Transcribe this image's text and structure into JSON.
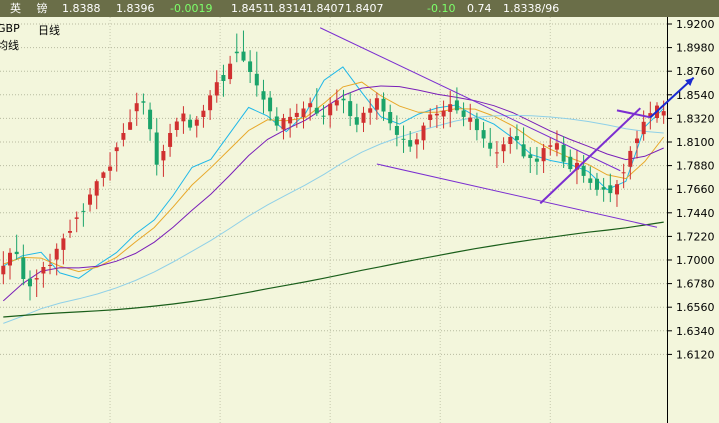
{
  "header": {
    "name": "英 镑",
    "fields": [
      {
        "text": "1.8388",
        "color": "pos"
      },
      {
        "text": "1.8396",
        "color": "pos"
      },
      {
        "text": "-0.0019",
        "color": "neg"
      },
      {
        "text": "1.8451",
        "color": "pos"
      },
      {
        "text": "1.8314",
        "color": "pos"
      },
      {
        "text": "1.8407",
        "color": "pos"
      },
      {
        "text": "1.8407",
        "color": "pos"
      },
      {
        "text": "-0.10",
        "color": "neg"
      },
      {
        "text": "0.74",
        "color": "pos"
      },
      {
        "text": "1.8338/96",
        "color": "pos"
      }
    ]
  },
  "legend": {
    "symbol": "GBP",
    "period": "日线",
    "indicator": "均线"
  },
  "colors": {
    "background": "#f3f6dc",
    "header_bg": "#6a6e48",
    "up_candle": "#d03030",
    "down_candle": "#1aa36a",
    "ma_short": "#1fb8e8",
    "ma_mid": "#e8a82a",
    "ma_long1": "#7a1fb8",
    "ma_long2": "#8fd0e8",
    "ma_long3": "#1a5e1a",
    "trendline": "#7b2ed0",
    "arrow": "#1a2ad0"
  },
  "chart_data": {
    "type": "candlestick",
    "title": "",
    "xlabel": "",
    "ylabel": "",
    "ylim": [
      1.5982,
      1.9265
    ],
    "y_ticks": [
      "1.9200",
      "1.8980",
      "1.8760",
      "1.8540",
      "1.8320",
      "1.8100",
      "1.7880",
      "1.7660",
      "1.7440",
      "1.7220",
      "1.7000",
      "1.6780",
      "1.6560",
      "1.6340",
      "1.6120"
    ],
    "grid": true,
    "series": [
      {
        "name": "MA short",
        "values": [
          1.6943,
          1.7039,
          1.7072,
          1.688,
          1.6829,
          1.6954,
          1.7069,
          1.7242,
          1.7374,
          1.7601,
          1.7863,
          1.7939,
          1.818,
          1.8423,
          1.8341,
          1.8197,
          1.8363,
          1.8676,
          1.8799,
          1.8562,
          1.8336,
          1.8267,
          1.836,
          1.8418,
          1.8445,
          1.8342,
          1.8267,
          1.8139,
          1.7982,
          1.7928,
          1.7894,
          1.7826,
          1.7656,
          1.7734,
          1.8241,
          1.8414
        ]
      },
      {
        "name": "MA mid",
        "values": [
          1.6962,
          1.7024,
          1.7018,
          1.6943,
          1.6892,
          1.6935,
          1.7025,
          1.7168,
          1.7303,
          1.7495,
          1.7699,
          1.786,
          1.8034,
          1.8207,
          1.8307,
          1.8298,
          1.8326,
          1.8462,
          1.8614,
          1.8658,
          1.8533,
          1.8435,
          1.8377,
          1.8378,
          1.8411,
          1.8407,
          1.8341,
          1.8251,
          1.8129,
          1.8032,
          1.7955,
          1.7891,
          1.7794,
          1.7759,
          1.7918,
          1.8147
        ]
      },
      {
        "name": "MA long 1",
        "values": [
          1.6619,
          1.6777,
          1.6896,
          1.6928,
          1.6926,
          1.6942,
          1.6989,
          1.7061,
          1.7166,
          1.7305,
          1.7464,
          1.7614,
          1.7789,
          1.7973,
          1.8124,
          1.8219,
          1.8302,
          1.8416,
          1.8533,
          1.8602,
          1.8622,
          1.8616,
          1.8584,
          1.8545,
          1.8517,
          1.8485,
          1.8438,
          1.8374,
          1.8288,
          1.8202,
          1.8127,
          1.806,
          1.7988,
          1.7936,
          1.7967,
          1.8044
        ]
      },
      {
        "name": "MA long 2",
        "values": [
          1.6409,
          1.6475,
          1.6546,
          1.6598,
          1.6638,
          1.6684,
          1.6741,
          1.6809,
          1.6889,
          1.6981,
          1.7081,
          1.7183,
          1.7294,
          1.7409,
          1.7514,
          1.7607,
          1.7698,
          1.7799,
          1.7909,
          1.8005,
          1.8082,
          1.8146,
          1.8201,
          1.825,
          1.8297,
          1.8329,
          1.8343,
          1.8348,
          1.8345,
          1.8333,
          1.8315,
          1.8291,
          1.8259,
          1.8224,
          1.8199,
          1.8184
        ]
      },
      {
        "name": "MA long 3",
        "values": [
          1.6469,
          1.6483,
          1.6497,
          1.6507,
          1.6516,
          1.6526,
          1.6538,
          1.6553,
          1.657,
          1.659,
          1.6613,
          1.6638,
          1.6667,
          1.6699,
          1.6732,
          1.6764,
          1.6796,
          1.683,
          1.6867,
          1.6904,
          1.6938,
          1.6973,
          1.7007,
          1.704,
          1.7074,
          1.7105,
          1.7134,
          1.7162,
          1.7188,
          1.7212,
          1.7236,
          1.7259,
          1.7279,
          1.73,
          1.7326,
          1.7353
        ]
      }
    ],
    "candles": [
      {
        "o": 1.6867,
        "h": 1.7082,
        "l": 1.6774,
        "c": 1.6946
      },
      {
        "o": 1.6949,
        "h": 1.711,
        "l": 1.6818,
        "c": 1.7067
      },
      {
        "o": 1.7076,
        "h": 1.7236,
        "l": 1.7003,
        "c": 1.7055
      },
      {
        "o": 1.7023,
        "h": 1.7144,
        "l": 1.6765,
        "c": 1.6823
      },
      {
        "o": 1.6826,
        "h": 1.6903,
        "l": 1.6623,
        "c": 1.6755
      },
      {
        "o": 1.6818,
        "h": 1.6912,
        "l": 1.6655,
        "c": 1.6831
      },
      {
        "o": 1.6874,
        "h": 1.6983,
        "l": 1.6742,
        "c": 1.6935
      },
      {
        "o": 1.6954,
        "h": 1.7058,
        "l": 1.6867,
        "c": 1.6954
      },
      {
        "o": 1.7004,
        "h": 1.7155,
        "l": 1.6857,
        "c": 1.7104
      },
      {
        "o": 1.7094,
        "h": 1.7246,
        "l": 1.6959,
        "c": 1.7201
      },
      {
        "o": 1.7253,
        "h": 1.7376,
        "l": 1.7206,
        "c": 1.727
      },
      {
        "o": 1.7383,
        "h": 1.7452,
        "l": 1.7259,
        "c": 1.7397
      },
      {
        "o": 1.7458,
        "h": 1.7529,
        "l": 1.731,
        "c": 1.7457
      },
      {
        "o": 1.7516,
        "h": 1.7671,
        "l": 1.7451,
        "c": 1.7611
      },
      {
        "o": 1.7601,
        "h": 1.7751,
        "l": 1.7474,
        "c": 1.7735
      },
      {
        "o": 1.7766,
        "h": 1.7826,
        "l": 1.7685,
        "c": 1.7817
      },
      {
        "o": 1.7832,
        "h": 1.8004,
        "l": 1.774,
        "c": 1.7871
      },
      {
        "o": 1.8016,
        "h": 1.8096,
        "l": 1.7824,
        "c": 1.8051
      },
      {
        "o": 1.8121,
        "h": 1.8275,
        "l": 1.8059,
        "c": 1.8184
      },
      {
        "o": 1.8214,
        "h": 1.8404,
        "l": 1.8213,
        "c": 1.8285
      },
      {
        "o": 1.8387,
        "h": 1.8559,
        "l": 1.825,
        "c": 1.8462
      },
      {
        "o": 1.8479,
        "h": 1.8552,
        "l": 1.8356,
        "c": 1.8466
      },
      {
        "o": 1.8401,
        "h": 1.8468,
        "l": 1.8111,
        "c": 1.8219
      },
      {
        "o": 1.8189,
        "h": 1.8321,
        "l": 1.7788,
        "c": 1.7889
      },
      {
        "o": 1.7928,
        "h": 1.8074,
        "l": 1.7775,
        "c": 1.8016
      },
      {
        "o": 1.8054,
        "h": 1.8269,
        "l": 1.7962,
        "c": 1.8184
      },
      {
        "o": 1.8212,
        "h": 1.8326,
        "l": 1.8149,
        "c": 1.8291
      },
      {
        "o": 1.8293,
        "h": 1.8434,
        "l": 1.8176,
        "c": 1.8366
      },
      {
        "o": 1.8308,
        "h": 1.8357,
        "l": 1.8206,
        "c": 1.8234
      },
      {
        "o": 1.8252,
        "h": 1.8342,
        "l": 1.8142,
        "c": 1.8309
      },
      {
        "o": 1.8333,
        "h": 1.8446,
        "l": 1.8233,
        "c": 1.8392
      },
      {
        "o": 1.8396,
        "h": 1.8584,
        "l": 1.8305,
        "c": 1.8534
      },
      {
        "o": 1.8533,
        "h": 1.8769,
        "l": 1.8466,
        "c": 1.8657
      },
      {
        "o": 1.8725,
        "h": 1.882,
        "l": 1.8522,
        "c": 1.8669
      },
      {
        "o": 1.8686,
        "h": 1.8903,
        "l": 1.864,
        "c": 1.883
      },
      {
        "o": 1.8942,
        "h": 1.9111,
        "l": 1.8844,
        "c": 1.8928
      },
      {
        "o": 1.8943,
        "h": 1.9139,
        "l": 1.8845,
        "c": 1.8859
      },
      {
        "o": 1.8851,
        "h": 1.8956,
        "l": 1.865,
        "c": 1.8752
      },
      {
        "o": 1.8736,
        "h": 1.8942,
        "l": 1.8523,
        "c": 1.8628
      },
      {
        "o": 1.8574,
        "h": 1.868,
        "l": 1.8366,
        "c": 1.8496
      },
      {
        "o": 1.8514,
        "h": 1.8575,
        "l": 1.8299,
        "c": 1.8386
      },
      {
        "o": 1.8338,
        "h": 1.8424,
        "l": 1.8204,
        "c": 1.8253
      },
      {
        "o": 1.8218,
        "h": 1.8362,
        "l": 1.8124,
        "c": 1.8323
      },
      {
        "o": 1.8273,
        "h": 1.8414,
        "l": 1.8141,
        "c": 1.8334
      },
      {
        "o": 1.8333,
        "h": 1.8456,
        "l": 1.8232,
        "c": 1.8371
      },
      {
        "o": 1.8332,
        "h": 1.8478,
        "l": 1.8226,
        "c": 1.8412
      },
      {
        "o": 1.8425,
        "h": 1.8514,
        "l": 1.8299,
        "c": 1.8462
      },
      {
        "o": 1.8419,
        "h": 1.8602,
        "l": 1.8342,
        "c": 1.8367
      },
      {
        "o": 1.8345,
        "h": 1.8444,
        "l": 1.8263,
        "c": 1.8338
      },
      {
        "o": 1.8349,
        "h": 1.8517,
        "l": 1.8233,
        "c": 1.8456
      },
      {
        "o": 1.8441,
        "h": 1.859,
        "l": 1.8391,
        "c": 1.8489
      },
      {
        "o": 1.8504,
        "h": 1.8586,
        "l": 1.8368,
        "c": 1.8489
      },
      {
        "o": 1.8481,
        "h": 1.8563,
        "l": 1.8249,
        "c": 1.8341
      },
      {
        "o": 1.8331,
        "h": 1.8457,
        "l": 1.8191,
        "c": 1.8261
      },
      {
        "o": 1.8279,
        "h": 1.8428,
        "l": 1.8193,
        "c": 1.8372
      },
      {
        "o": 1.8373,
        "h": 1.8503,
        "l": 1.8261,
        "c": 1.8414
      },
      {
        "o": 1.8401,
        "h": 1.8561,
        "l": 1.8307,
        "c": 1.8508
      },
      {
        "o": 1.8503,
        "h": 1.8562,
        "l": 1.8297,
        "c": 1.8385
      },
      {
        "o": 1.838,
        "h": 1.8448,
        "l": 1.8209,
        "c": 1.8275
      },
      {
        "o": 1.8249,
        "h": 1.8348,
        "l": 1.806,
        "c": 1.8166
      },
      {
        "o": 1.813,
        "h": 1.8254,
        "l": 1.7998,
        "c": 1.8122
      },
      {
        "o": 1.8118,
        "h": 1.8202,
        "l": 1.8008,
        "c": 1.8057
      },
      {
        "o": 1.8077,
        "h": 1.8183,
        "l": 1.7946,
        "c": 1.8124
      },
      {
        "o": 1.8116,
        "h": 1.8282,
        "l": 1.8028,
        "c": 1.8253
      },
      {
        "o": 1.8305,
        "h": 1.8414,
        "l": 1.8236,
        "c": 1.8356
      },
      {
        "o": 1.8348,
        "h": 1.8444,
        "l": 1.823,
        "c": 1.8363
      },
      {
        "o": 1.8338,
        "h": 1.8486,
        "l": 1.8226,
        "c": 1.8394
      },
      {
        "o": 1.838,
        "h": 1.8578,
        "l": 1.8238,
        "c": 1.8452
      },
      {
        "o": 1.8488,
        "h": 1.8609,
        "l": 1.8364,
        "c": 1.8396
      },
      {
        "o": 1.8394,
        "h": 1.8469,
        "l": 1.8247,
        "c": 1.8334
      },
      {
        "o": 1.8288,
        "h": 1.8456,
        "l": 1.8212,
        "c": 1.8327
      },
      {
        "o": 1.8317,
        "h": 1.8373,
        "l": 1.8115,
        "c": 1.8211
      },
      {
        "o": 1.8211,
        "h": 1.8286,
        "l": 1.8046,
        "c": 1.8133
      },
      {
        "o": 1.8093,
        "h": 1.8231,
        "l": 1.7967,
        "c": 1.8038
      },
      {
        "o": 1.7997,
        "h": 1.8109,
        "l": 1.7858,
        "c": 1.8003
      },
      {
        "o": 1.8015,
        "h": 1.8144,
        "l": 1.7905,
        "c": 1.8079
      },
      {
        "o": 1.8082,
        "h": 1.8233,
        "l": 1.7991,
        "c": 1.8147
      },
      {
        "o": 1.8155,
        "h": 1.8264,
        "l": 1.8031,
        "c": 1.8118
      },
      {
        "o": 1.8079,
        "h": 1.8236,
        "l": 1.7947,
        "c": 1.7966
      },
      {
        "o": 1.7983,
        "h": 1.8052,
        "l": 1.7811,
        "c": 1.7951
      },
      {
        "o": 1.7945,
        "h": 1.8054,
        "l": 1.7794,
        "c": 1.7916
      },
      {
        "o": 1.7921,
        "h": 1.8082,
        "l": 1.7811,
        "c": 1.8043
      },
      {
        "o": 1.8055,
        "h": 1.8141,
        "l": 1.7974,
        "c": 1.8069
      },
      {
        "o": 1.8029,
        "h": 1.8208,
        "l": 1.7967,
        "c": 1.8089
      },
      {
        "o": 1.8074,
        "h": 1.8153,
        "l": 1.7858,
        "c": 1.7916
      },
      {
        "o": 1.7962,
        "h": 1.803,
        "l": 1.7822,
        "c": 1.7847
      },
      {
        "o": 1.7842,
        "h": 1.8028,
        "l": 1.7707,
        "c": 1.7905
      },
      {
        "o": 1.7877,
        "h": 1.7979,
        "l": 1.772,
        "c": 1.7784
      },
      {
        "o": 1.7761,
        "h": 1.7873,
        "l": 1.7654,
        "c": 1.7719
      },
      {
        "o": 1.7757,
        "h": 1.7812,
        "l": 1.7599,
        "c": 1.7654
      },
      {
        "o": 1.7679,
        "h": 1.7765,
        "l": 1.7543,
        "c": 1.7656
      },
      {
        "o": 1.7696,
        "h": 1.7805,
        "l": 1.754,
        "c": 1.7623
      },
      {
        "o": 1.7612,
        "h": 1.7746,
        "l": 1.7495,
        "c": 1.7707
      },
      {
        "o": 1.7809,
        "h": 1.7897,
        "l": 1.7669,
        "c": 1.7818
      },
      {
        "o": 1.7869,
        "h": 1.8061,
        "l": 1.7751,
        "c": 1.8017
      },
      {
        "o": 1.809,
        "h": 1.8205,
        "l": 1.7946,
        "c": 1.8133
      },
      {
        "o": 1.8173,
        "h": 1.8394,
        "l": 1.8112,
        "c": 1.8288
      },
      {
        "o": 1.8335,
        "h": 1.8476,
        "l": 1.8217,
        "c": 1.8369
      },
      {
        "o": 1.8323,
        "h": 1.8471,
        "l": 1.8279,
        "c": 1.8439
      },
      {
        "o": 1.8347,
        "h": 1.8486,
        "l": 1.8269,
        "c": 1.8388
      }
    ],
    "annotations": [
      {
        "type": "trendline",
        "from": [
          0.48,
          1.9165
        ],
        "to": [
          0.93,
          1.7832
        ]
      },
      {
        "type": "trendline",
        "from": [
          0.565,
          1.7895
        ],
        "to": [
          0.985,
          1.7305
        ]
      },
      {
        "type": "trendline",
        "from": [
          0.81,
          1.7528
        ],
        "to": [
          0.96,
          1.8415
        ]
      },
      {
        "type": "trendline",
        "from": [
          0.925,
          1.8395
        ],
        "to": [
          0.975,
          1.833
        ]
      },
      {
        "type": "arrow",
        "from": [
          0.975,
          1.833
        ],
        "to": [
          1.04,
          1.87
        ]
      }
    ]
  }
}
